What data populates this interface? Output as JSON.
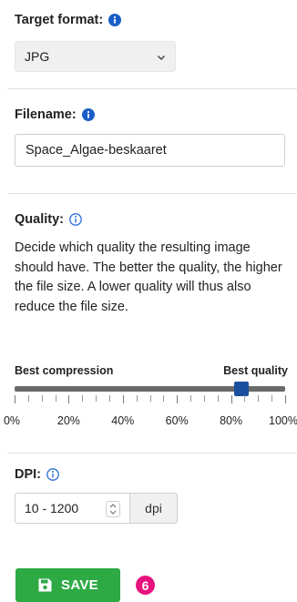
{
  "target_format": {
    "label": "Target format:",
    "selected": "JPG"
  },
  "filename": {
    "label": "Filename:",
    "value": "Space_Algae-beskaaret"
  },
  "quality": {
    "label": "Quality:",
    "description": "Decide which quality the resulting image should have. The better the quality, the higher the file size. A lower quality will thus also reduce the file size.",
    "min_label": "Best compression",
    "max_label": "Best quality",
    "value_percent": 84,
    "ticks": [
      "0%",
      "20%",
      "40%",
      "60%",
      "80%",
      "100%"
    ]
  },
  "dpi": {
    "label": "DPI:",
    "placeholder": "10 - 1200",
    "unit": "dpi"
  },
  "actions": {
    "save_label": "SAVE",
    "step_number": "6"
  },
  "colors": {
    "info_icon_solid": "#1a5fc7",
    "info_icon_outline": "#2a6fd6",
    "slider_thumb": "#1a4fa0",
    "save_button": "#2eaa45",
    "step_badge": "#e8127c"
  }
}
